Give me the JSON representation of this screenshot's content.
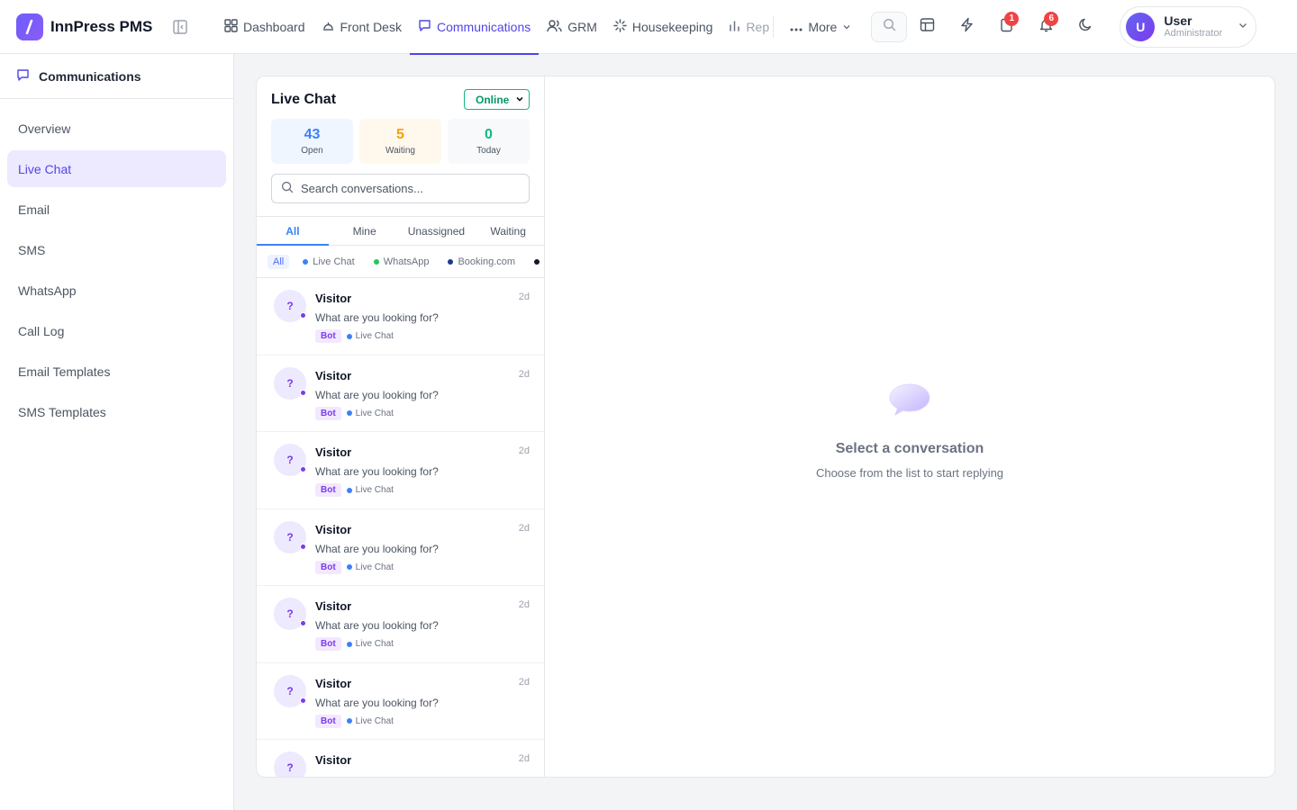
{
  "app": {
    "name": "InnPress PMS"
  },
  "nav": {
    "items": [
      {
        "label": "Dashboard",
        "icon": "grid-icon"
      },
      {
        "label": "Front Desk",
        "icon": "bell-desk-icon"
      },
      {
        "label": "Communications",
        "icon": "message-icon",
        "active": true
      },
      {
        "label": "GRM",
        "icon": "users-icon"
      },
      {
        "label": "Housekeeping",
        "icon": "sparkle-icon"
      },
      {
        "label": "Repo",
        "icon": "bar-chart-icon"
      }
    ],
    "more_label": "More"
  },
  "toolbar": {
    "notifications_count": "1",
    "alerts_count": "6"
  },
  "user": {
    "initial": "U",
    "name": "User",
    "role": "Administrator"
  },
  "sidebar": {
    "title": "Communications",
    "items": [
      {
        "label": "Overview"
      },
      {
        "label": "Live Chat",
        "active": true
      },
      {
        "label": "Email"
      },
      {
        "label": "SMS"
      },
      {
        "label": "WhatsApp"
      },
      {
        "label": "Call Log"
      },
      {
        "label": "Email Templates"
      },
      {
        "label": "SMS Templates"
      }
    ]
  },
  "live_chat": {
    "title": "Live Chat",
    "status": "Online",
    "stats": [
      {
        "value": "43",
        "label": "Open"
      },
      {
        "value": "5",
        "label": "Waiting"
      },
      {
        "value": "0",
        "label": "Today"
      }
    ],
    "search_placeholder": "Search conversations...",
    "tabs": [
      "All",
      "Mine",
      "Unassigned",
      "Waiting"
    ],
    "channel_filters": [
      {
        "label": "All",
        "color": ""
      },
      {
        "label": "Live Chat",
        "color": "#3b82f6"
      },
      {
        "label": "WhatsApp",
        "color": "#22c55e"
      },
      {
        "label": "Booking.com",
        "color": "#1e3a8a"
      }
    ],
    "conversations": [
      {
        "initial": "?",
        "name": "Visitor",
        "time": "2d",
        "message": "What are you looking for?",
        "tag": "Bot",
        "channel": "Live Chat"
      },
      {
        "initial": "?",
        "name": "Visitor",
        "time": "2d",
        "message": "What are you looking for?",
        "tag": "Bot",
        "channel": "Live Chat"
      },
      {
        "initial": "?",
        "name": "Visitor",
        "time": "2d",
        "message": "What are you looking for?",
        "tag": "Bot",
        "channel": "Live Chat"
      },
      {
        "initial": "?",
        "name": "Visitor",
        "time": "2d",
        "message": "What are you looking for?",
        "tag": "Bot",
        "channel": "Live Chat"
      },
      {
        "initial": "?",
        "name": "Visitor",
        "time": "2d",
        "message": "What are you looking for?",
        "tag": "Bot",
        "channel": "Live Chat"
      },
      {
        "initial": "?",
        "name": "Visitor",
        "time": "2d",
        "message": "What are you looking for?",
        "tag": "Bot",
        "channel": "Live Chat"
      },
      {
        "initial": "?",
        "name": "Visitor",
        "time": "2d",
        "message": "",
        "tag": "",
        "channel": ""
      }
    ]
  },
  "detail": {
    "empty_title": "Select a conversation",
    "empty_subtitle": "Choose from the list to start replying"
  },
  "colors": {
    "accent": "#4f46e5",
    "brand": "#7c3aed",
    "online": "#10b981",
    "badge": "#ef4444"
  }
}
